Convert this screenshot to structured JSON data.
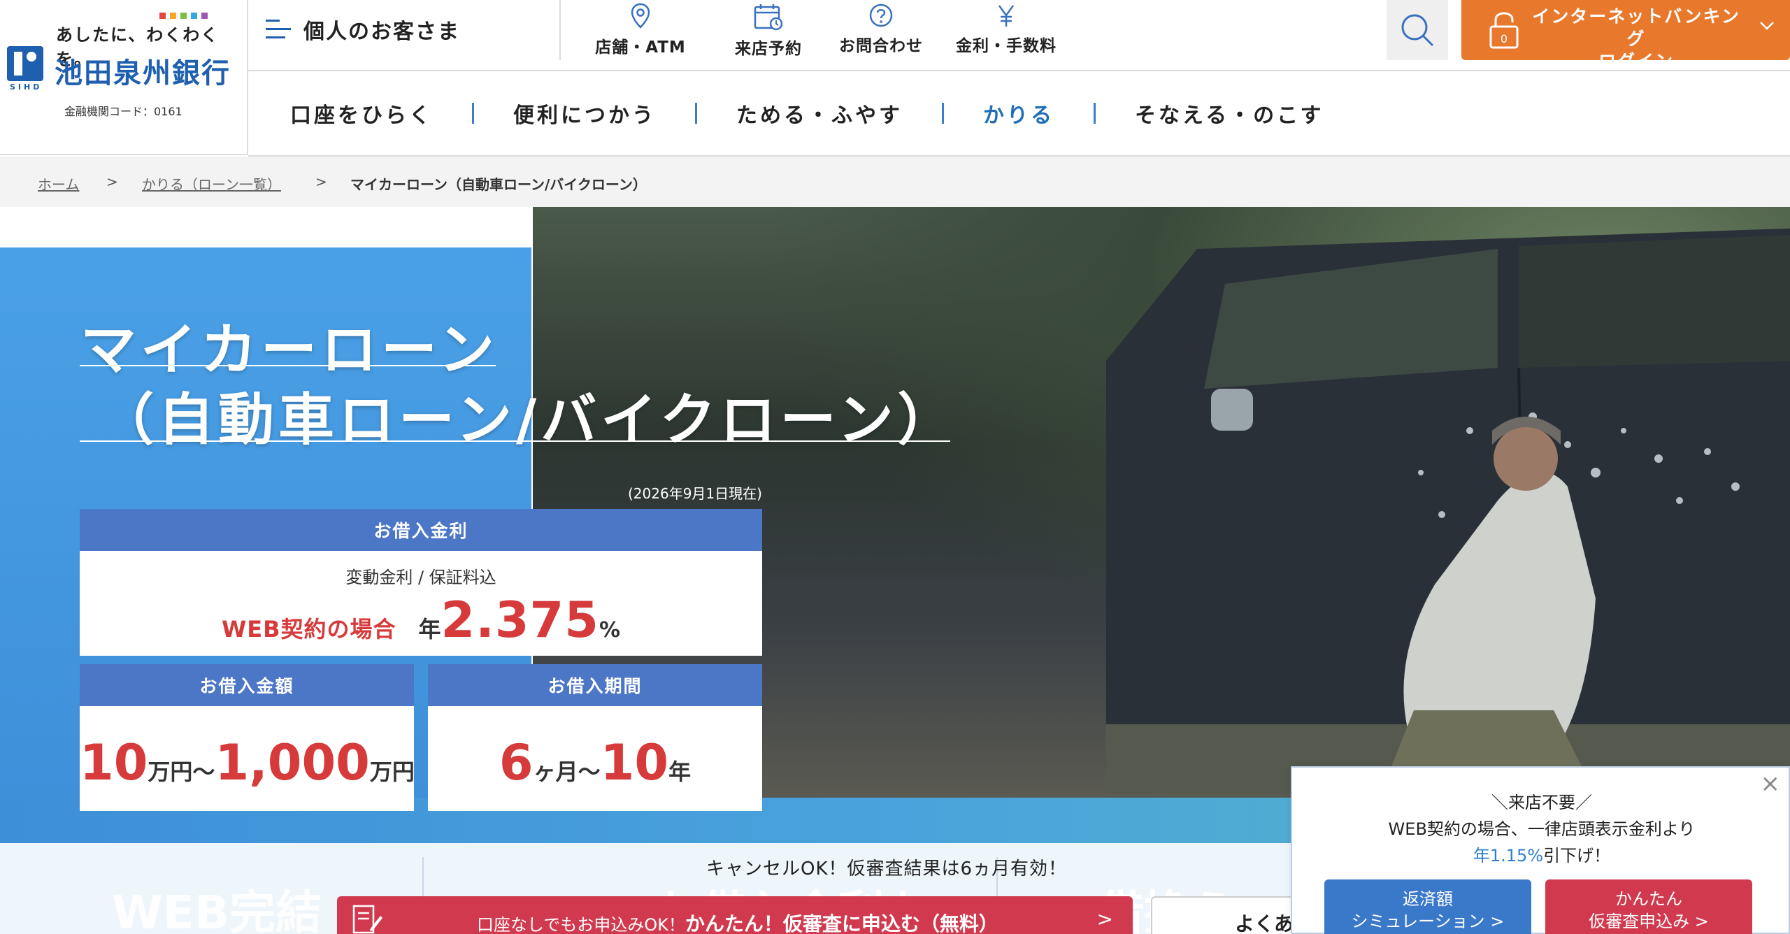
{
  "header": {
    "tagline": "あしたに、わくわくを。",
    "bank_name": "池田泉州銀行",
    "logo_sub": "SIHD",
    "institution_code": "金融機関コード：0161",
    "segment_label": "個人のお客さま",
    "utility": [
      {
        "label": "店舗・ATM",
        "icon": "map-pin-icon"
      },
      {
        "label": "来店予約",
        "icon": "calendar-icon"
      },
      {
        "label": "お問合わせ",
        "icon": "question-icon"
      },
      {
        "label": "金利・手数料",
        "icon": "yen-icon"
      }
    ],
    "search_icon": "search-icon",
    "ib_line1": "インターネットバンキング",
    "ib_line2": "ログイン",
    "ib_badge": "0",
    "colors": {
      "brand": "#1f5fb0",
      "ib": "#e8782c"
    }
  },
  "gnav": [
    {
      "label": "口座をひらく",
      "active": false
    },
    {
      "label": "便利につかう",
      "active": false
    },
    {
      "label": "ためる・ふやす",
      "active": false
    },
    {
      "label": "かりる",
      "active": true
    },
    {
      "label": "そなえる・のこす",
      "active": false
    }
  ],
  "breadcrumb": {
    "home": "ホーム",
    "sep": ">",
    "parent": "かりる（ローン一覧）",
    "current": "マイカーローン（自動車ローン/バイクローン）"
  },
  "hero": {
    "title_line1": "マイカーローン",
    "title_line2": "（自動車ローン/バイクローン）",
    "as_of": "(2026年9月1日現在)",
    "rate": {
      "heading": "お借入金利",
      "subtitle": "変動金利 / 保証料込",
      "web_label": "WEB契約の場合",
      "prefix": "年",
      "value": "2.375",
      "unit": "%"
    },
    "amount": {
      "heading": "お借入金額",
      "min": "10",
      "min_unit": "万円～",
      "max": "1,000",
      "max_unit": "万円"
    },
    "term": {
      "heading": "お借入期間",
      "min": "6",
      "min_unit": "ヶ月～",
      "max": "10",
      "max_unit": "年"
    },
    "colors": {
      "accent_red": "#d63a3a",
      "card_head": "#4c76c6",
      "hero_blue": "#3d8fd8"
    }
  },
  "below": {
    "ghost1": "WEB完結",
    "ghost2": "お借入金利も",
    "ghost3": "借換え",
    "cancel_note": "キャンセルOK！仮審査結果は6ヵ月有効！",
    "apply_pre": "口座なしでもお申込みOK！",
    "apply_main": "かんたん！仮審査に申込む（無料）",
    "apply_chev": ">",
    "faq_label": "よくあ"
  },
  "popup": {
    "close": "×",
    "line1": "＼来店不要／",
    "line2": "WEB契約の場合、一律店頭表示金利より",
    "line3_highlight": "年1.15%",
    "line3_rest": "引下げ！",
    "btn_sim_line1": "返済額",
    "btn_sim_line2": "シミュレーション >",
    "btn_pre_line1": "かんたん",
    "btn_pre_line2": "仮審査申込み >"
  }
}
